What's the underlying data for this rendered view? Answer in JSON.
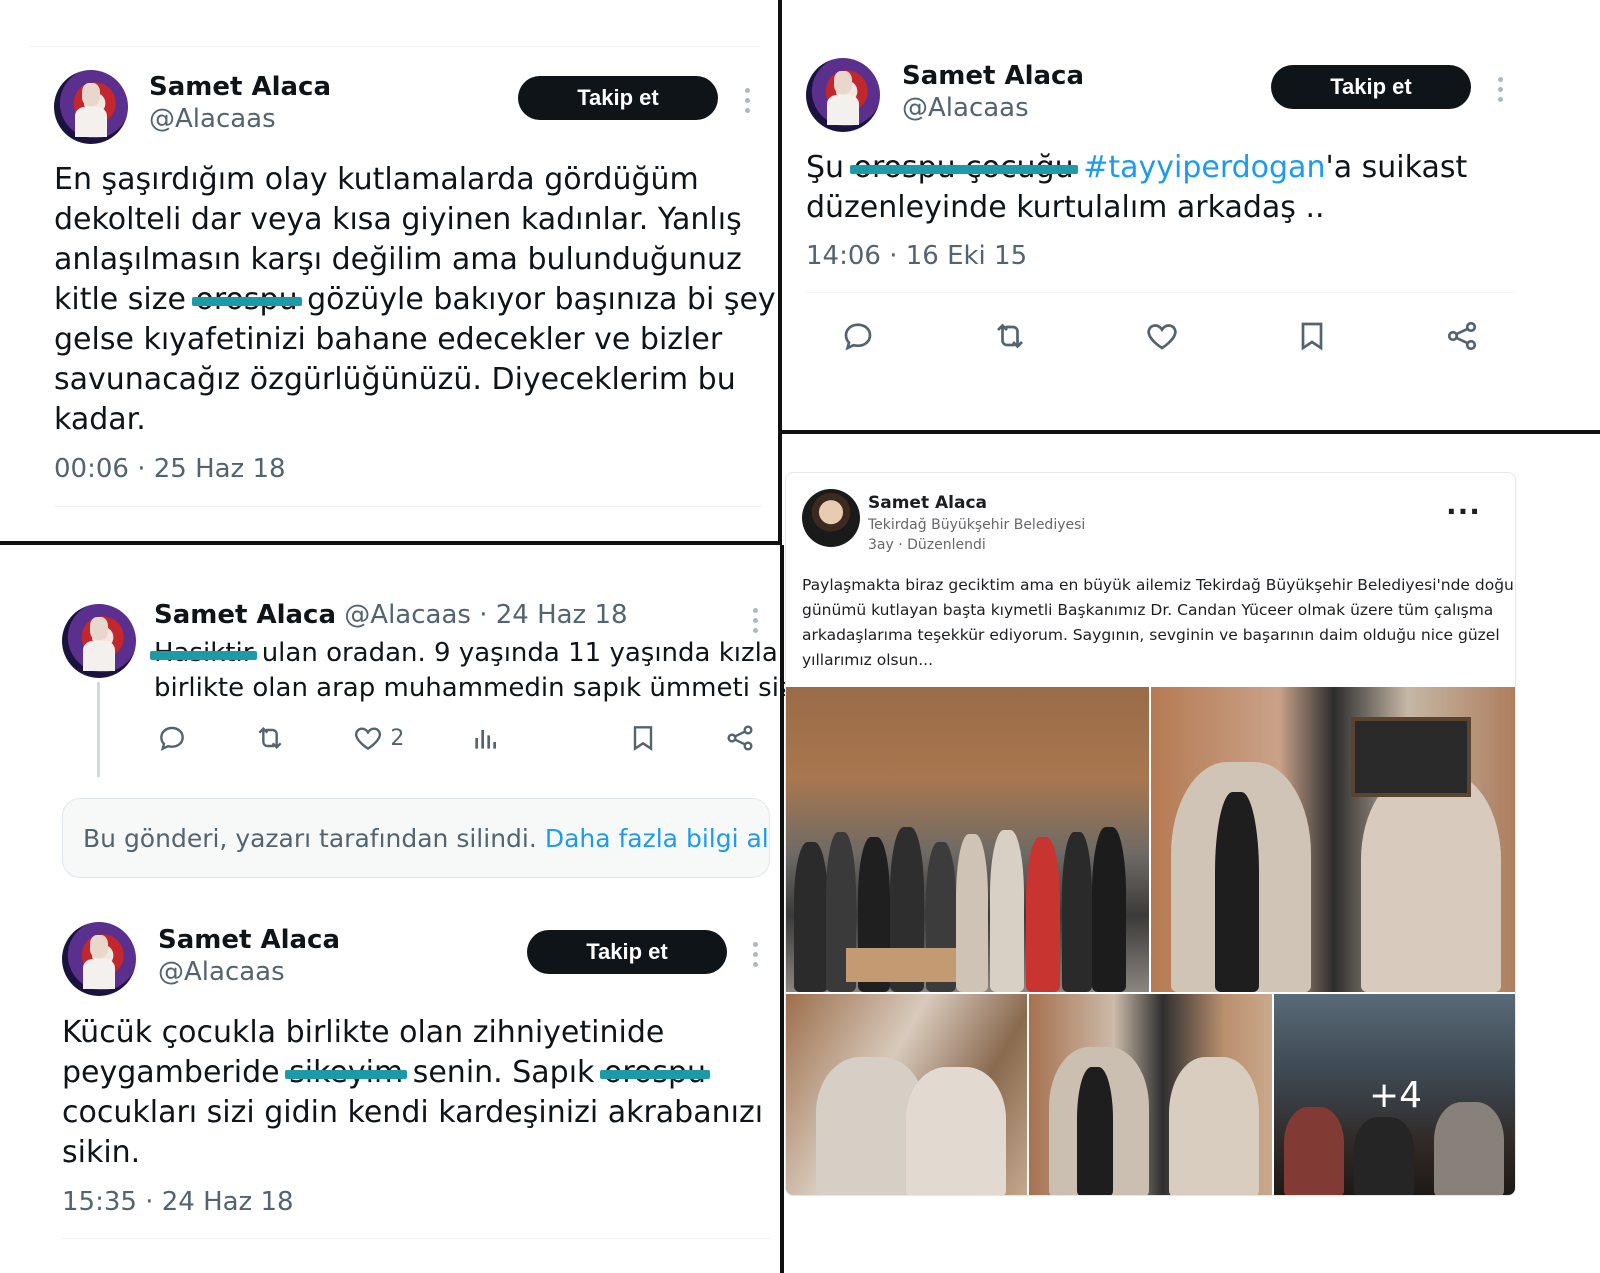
{
  "tweet1": {
    "name": "Samet Alaca",
    "handle": "@Alacaas",
    "follow_label": "Takip et",
    "text_l1": "En şaşırdığım olay kutlamalarda gördüğüm",
    "text_l2": "dekolteli dar veya kısa giyinen kadınlar. Yanlış",
    "text_l3": "anlaşılmasın karşı değilim ama bulunduğunuz",
    "text_l4a": "kitle size",
    "text_l4_redacted": "orospu",
    "text_l4b": "gözüyle bakıyor başınıza bi şey",
    "text_l5": "gelse kıyafetinizi bahane edecekler ve bizler",
    "text_l6": "savunacağız özgürlüğünüzü. Diyeceklerim bu",
    "text_l7": "kadar.",
    "timestamp": "00:06 · 25 Haz 18"
  },
  "tweet2": {
    "name": "Samet Alaca",
    "handle": "@Alacaas",
    "follow_label": "Takip et",
    "text_a": "Şu",
    "text_redacted": "orospu çocuğu",
    "hashtag": "#tayyiperdogan",
    "text_b": "'a suikast",
    "text_l2": "düzenleyinde kurtulalım arkadaş ..",
    "timestamp": "14:06 · 16 Eki 15"
  },
  "tweet3": {
    "name": "Samet Alaca",
    "handle_date": "@Alacaas · 24 Haz 18",
    "text_redacted": "Hasiktir",
    "text_l1": "ulan oradan. 9 yaşında 11 yaşında kızla",
    "text_l2": "birlikte olan arap muhammedin sapık ümmeti sizi",
    "like_count": "2"
  },
  "deleted_notice": {
    "text": "Bu gönderi, yazarı tarafından silindi.",
    "link": "Daha fazla bilgi al"
  },
  "tweet4": {
    "name": "Samet Alaca",
    "handle": "@Alacaas",
    "follow_label": "Takip et",
    "text_l1": "Kücük çocukla birlikte olan zihniyetinide",
    "text_l2a": "peygamberide",
    "text_l2_redacted": "sikeyim",
    "text_l2b": "senin. Sapık",
    "text_l2_redacted2": "orospu",
    "text_l3": "cocukları sizi gidin kendi kardeşinizi akrabanızı",
    "text_l4": "sikin.",
    "timestamp": "15:35 · 24 Haz 18"
  },
  "facebook_post": {
    "name": "Samet Alaca",
    "page": "Tekirdağ Büyükşehir Belediyesi",
    "time": "3ay · Düzenlendi",
    "more": "···",
    "text_l1": "Paylaşmakta biraz geciktim ama en büyük ailemiz Tekirdağ Büyükşehir Belediyesi'nde doğum",
    "text_l2": "günümü kutlayan başta kıymetli Başkanımız Dr. Candan Yüceer olmak üzere tüm çalışma",
    "text_l3": "arkadaşlarıma teşekkür ediyorum. Saygının, sevginin ve başarının daim olduğu nice güzel",
    "text_l4": "yıllarımız olsun...",
    "more_photos": "+4"
  },
  "icons": [
    "reply-icon",
    "retweet-icon",
    "like-icon",
    "bookmark-icon",
    "share-icon",
    "views-icon",
    "more-icon"
  ],
  "colors": {
    "redaction": "#1d9aa8",
    "link": "#1d9bf0",
    "follow_bg": "#0f1419"
  }
}
